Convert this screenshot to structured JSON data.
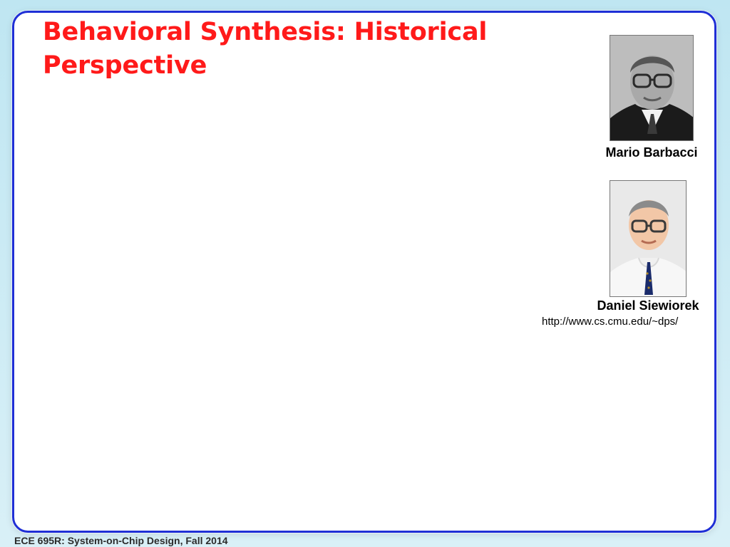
{
  "slide": {
    "title_line1": "Behavioral Synthesis: Historical",
    "title_line2": "Perspective",
    "footer": "ECE 695R: System-on-Chip Design, Fall 2014"
  },
  "people": [
    {
      "name": "Mario Barbacci",
      "photo_style": "grayscale",
      "accent_color": "#1f2fd6"
    },
    {
      "name": "Daniel Siewiorek",
      "photo_style": "color",
      "url": "http://www.cs.cmu.edu/~dps/"
    }
  ],
  "colors": {
    "title": "#ff1a1a",
    "frame_border": "#1f2fd6",
    "background": "#bfe6f2"
  }
}
